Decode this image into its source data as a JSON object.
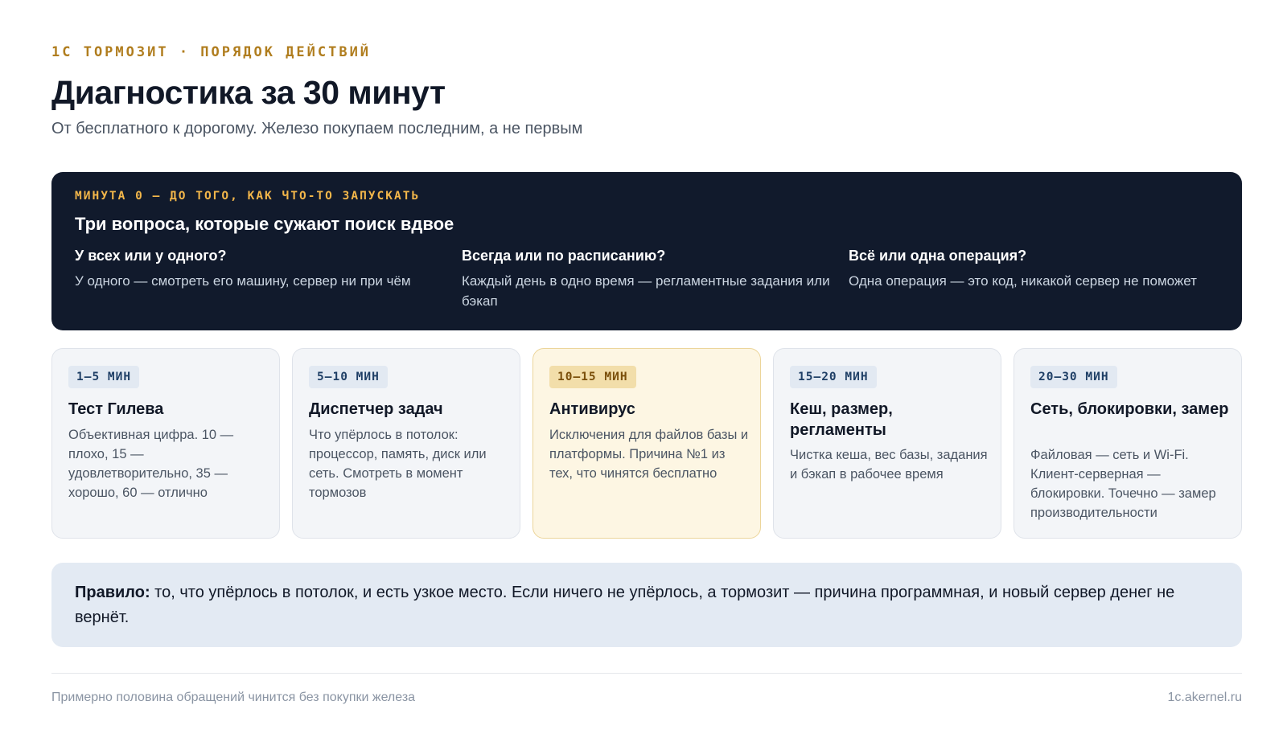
{
  "header": {
    "eyebrow": "1С ТОРМОЗИТ · ПОРЯДОК ДЕЙСТВИЙ",
    "title": "Диагностика за 30 минут",
    "subtitle": "От бесплатного к дорогому. Железо покупаем последним, а не первым"
  },
  "intro": {
    "kicker": "МИНУТА 0 — ДО ТОГО, КАК ЧТО-ТО ЗАПУСКАТЬ",
    "title": "Три вопроса, которые сужают поиск вдвое",
    "questions": [
      {
        "title": "У всех или у одного?",
        "text": "У одного — смотреть его машину, сервер ни при чём"
      },
      {
        "title": "Всегда или по расписанию?",
        "text": "Каждый день в одно время — регламентные задания или бэкап"
      },
      {
        "title": "Всё или одна операция?",
        "text": "Одна операция — это код, никакой сервер не поможет"
      }
    ]
  },
  "steps": [
    {
      "time": "1–5 МИН",
      "title": "Тест Гилева",
      "text": "Объективная цифра. 10 — плохо, 15 — удовлетворительно, 35 — хорошо, 60 — отлично"
    },
    {
      "time": "5–10 МИН",
      "title": "Диспетчер задач",
      "text": "Что упёрлось в потолок: процессор, память, диск или сеть. Смотреть в момент тормозов"
    },
    {
      "time": "10–15 МИН",
      "title": "Антивирус",
      "text": "Исключения для файлов базы и платформы. Причина №1 из тех, что чинятся бесплатно"
    },
    {
      "time": "15–20 МИН",
      "title": "Кеш, размер, регламенты",
      "text": "Чистка кеша, вес базы, задания и бэкап в рабочее время"
    },
    {
      "time": "20–30 МИН",
      "title": "Сеть, блокировки, замер",
      "text": "Файловая — сеть и Wi-Fi. Клиент-серверная — блокировки. Точечно — замер производительности"
    }
  ],
  "rule": {
    "label": "Правило:",
    "text": " то, что упёрлось в потолок, и есть узкое место. Если ничего не упёрлось, а тормозит — причина программная, и новый сервер денег не вернёт."
  },
  "footer": {
    "left": "Примерно половина обращений чинится без покупки железа",
    "right": "1c.akernel.ru"
  },
  "colors": {
    "accent": "#b07d1e",
    "dark_panel": "#111a2c",
    "highlight_card": "#fdf6e3",
    "rule_box": "#e3eaf3"
  }
}
